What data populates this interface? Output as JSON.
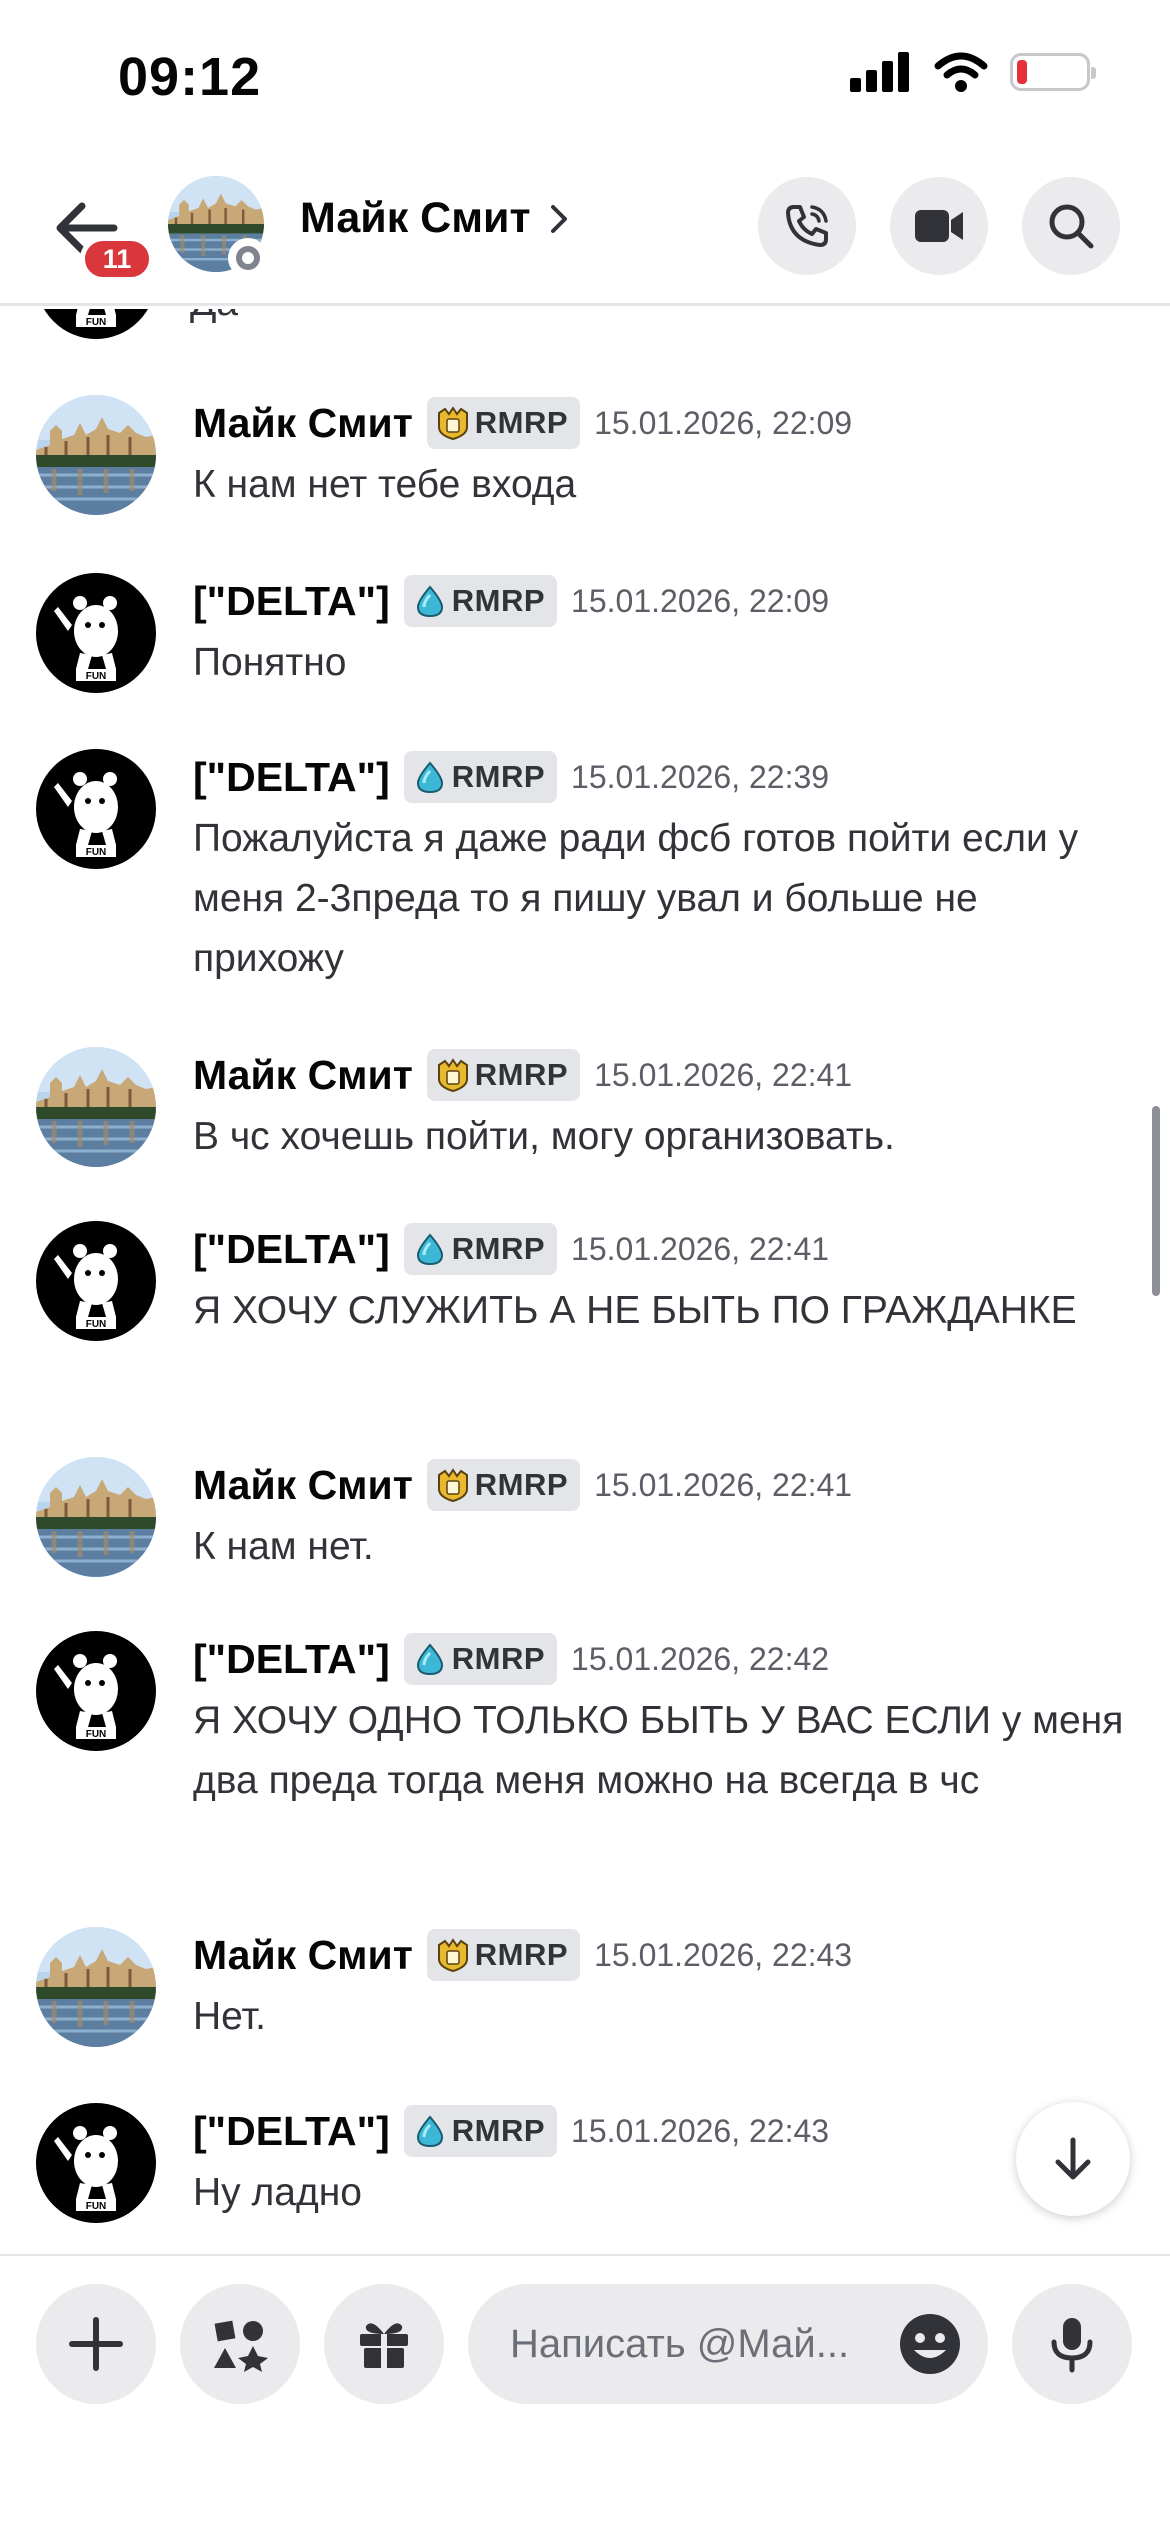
{
  "status_bar": {
    "time": "09:12"
  },
  "header": {
    "badge_count": "11",
    "title": "Майк Смит"
  },
  "messages": {
    "partial": {
      "text": "Да"
    },
    "items": [
      {
        "author": "Майк Смит",
        "tag": "RMRP",
        "tag_icon": "shield-crown-icon",
        "timestamp": "15.01.2026, 22:09",
        "text": "К нам нет тебе входа"
      },
      {
        "author": "[\"DELTA\"]",
        "tag": "RMRP",
        "tag_icon": "water-drop-icon",
        "timestamp": "15.01.2026, 22:09",
        "text": "Понятно"
      },
      {
        "author": "[\"DELTA\"]",
        "tag": "RMRP",
        "tag_icon": "water-drop-icon",
        "timestamp": "15.01.2026, 22:39",
        "text": "Пожалуйста я даже ради фсб готов пойти если у меня 2-3преда то я пишу увал и больше не прихожу"
      },
      {
        "author": "Майк Смит",
        "tag": "RMRP",
        "tag_icon": "shield-crown-icon",
        "timestamp": "15.01.2026, 22:41",
        "text": "В чс хочешь пойти, могу организовать."
      },
      {
        "author": "[\"DELTA\"]",
        "tag": "RMRP",
        "tag_icon": "water-drop-icon",
        "timestamp": "15.01.2026, 22:41",
        "text": "Я ХОЧУ СЛУЖИТЬ А НЕ БЫТЬ ПО ГРАЖДАНКЕ"
      },
      {
        "author": "Майк Смит",
        "tag": "RMRP",
        "tag_icon": "shield-crown-icon",
        "timestamp": "15.01.2026, 22:41",
        "text": "К нам нет."
      },
      {
        "author": "[\"DELTA\"]",
        "tag": "RMRP",
        "tag_icon": "water-drop-icon",
        "timestamp": "15.01.2026, 22:42",
        "text": "Я ХОЧУ ОДНО ТОЛЬКО БЫТЬ У ВАС ЕСЛИ у меня два преда тогда меня можно на всегда в чс"
      },
      {
        "author": "Майк Смит",
        "tag": "RMRP",
        "tag_icon": "shield-crown-icon",
        "timestamp": "15.01.2026, 22:43",
        "text": "Нет."
      },
      {
        "author": "[\"DELTA\"]",
        "tag": "RMRP",
        "tag_icon": "water-drop-icon",
        "timestamp": "15.01.2026, 22:43",
        "text": "Ну ладно"
      }
    ]
  },
  "composer": {
    "placeholder": "Написать @Май..."
  },
  "colors": {
    "accent_red": "#da373c",
    "tag_bg": "#e3e5e8",
    "button_bg": "#ebebed"
  }
}
